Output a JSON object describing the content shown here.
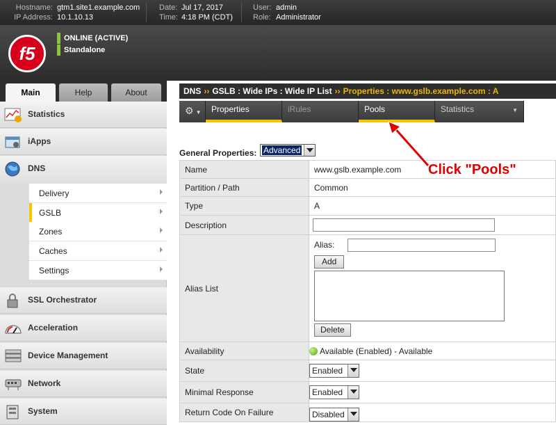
{
  "system": {
    "hostname_label": "Hostname:",
    "hostname": "gtm1.site1.example.com",
    "ip_label": "IP Address:",
    "ip": "10.1.10.13",
    "date_label": "Date:",
    "date": "Jul 17, 2017",
    "time_label": "Time:",
    "time": "4:18 PM (CDT)",
    "user_label": "User:",
    "user": "admin",
    "role_label": "Role:",
    "role": "Administrator"
  },
  "banner": {
    "logo_text": "f5",
    "status": "ONLINE (ACTIVE)",
    "mode": "Standalone",
    "status_color": "#8cc63f"
  },
  "main_tabs": [
    {
      "label": "Main"
    },
    {
      "label": "Help"
    },
    {
      "label": "About"
    }
  ],
  "sidebar": {
    "items": [
      {
        "label": "Statistics",
        "icon": "statistics-icon"
      },
      {
        "label": "iApps",
        "icon": "iapps-icon"
      },
      {
        "label": "DNS",
        "icon": "globe-icon"
      },
      {
        "label": "SSL Orchestrator",
        "icon": "lock-icon"
      },
      {
        "label": "Acceleration",
        "icon": "gauge-icon"
      },
      {
        "label": "Device Management",
        "icon": "server-icon"
      },
      {
        "label": "Network",
        "icon": "network-icon"
      },
      {
        "label": "System",
        "icon": "system-icon"
      }
    ],
    "dns_subitems": [
      {
        "label": "Delivery"
      },
      {
        "label": "GSLB"
      },
      {
        "label": "Zones"
      },
      {
        "label": "Caches"
      },
      {
        "label": "Settings"
      }
    ],
    "selected_subitem": "GSLB"
  },
  "breadcrumb": {
    "parts": [
      "DNS",
      "GSLB : Wide IPs : Wide IP List"
    ],
    "separator": "››",
    "current": "Properties : www.gslb.example.com : A"
  },
  "page_tabs": [
    {
      "label": "Properties"
    },
    {
      "label": "iRules"
    },
    {
      "label": "Pools"
    },
    {
      "label": "Statistics"
    }
  ],
  "general_properties": {
    "label": "General Properties:",
    "view": "Advanced"
  },
  "properties": {
    "name": {
      "label": "Name",
      "value": "www.gslb.example.com"
    },
    "partition": {
      "label": "Partition / Path",
      "value": "Common"
    },
    "type": {
      "label": "Type",
      "value": "A"
    },
    "description": {
      "label": "Description",
      "value": ""
    },
    "alias": {
      "label": "Alias List",
      "alias_label": "Alias:",
      "alias_value": "",
      "add": "Add",
      "delete": "Delete"
    },
    "availability": {
      "label": "Availability",
      "value": "Available (Enabled) - Available"
    },
    "state": {
      "label": "State",
      "value": "Enabled"
    },
    "minimal_response": {
      "label": "Minimal Response",
      "value": "Enabled"
    },
    "return_code": {
      "label": "Return Code On Failure",
      "value": "Disabled"
    }
  },
  "annotation": {
    "text": "Click \"Pools\"",
    "color": "#e00000"
  }
}
